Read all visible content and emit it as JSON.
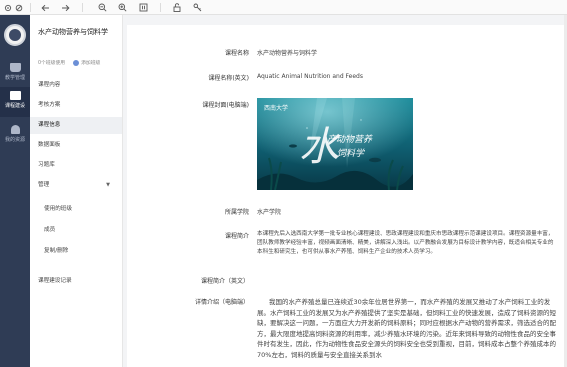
{
  "toolbar": {
    "icons": [
      "settings-icon",
      "link-icon",
      "back-arrow-icon",
      "forward-arrow-icon",
      "zoom-out-icon",
      "zoom-in-icon",
      "fit-page-icon",
      "unlock-icon",
      "key-icon"
    ]
  },
  "nav": {
    "items": [
      {
        "label": "教学管理",
        "icon": "teaching-management-icon"
      },
      {
        "label": "课程建设",
        "icon": "course-building-icon"
      },
      {
        "label": "我的资源",
        "icon": "my-resources-icon"
      }
    ],
    "active_index": 1
  },
  "sidebar": {
    "course_title": "水产动物营养与饲料学",
    "meta_used": "0个班级使用",
    "meta_add": "添加班级",
    "menu": [
      {
        "label": "课程内容"
      },
      {
        "label": "考核方案"
      },
      {
        "label": "课程信息"
      },
      {
        "label": "数据面板"
      },
      {
        "label": "习题库"
      },
      {
        "label": "管理"
      },
      {
        "label": "使用的班级"
      },
      {
        "label": "成员"
      },
      {
        "label": "复制/删除"
      },
      {
        "label": "课程建设记录"
      }
    ],
    "active_index": 2
  },
  "course_info": {
    "name_label": "课程名称",
    "name_value": "水产动物营养与饲料学",
    "name_en_label": "课程名称(英文)",
    "name_en_value": "Aquatic Animal Nutrition and Feeds",
    "cover_label": "课程封面(电脑端)",
    "cover_title_big": "水",
    "cover_title_small": "产动物营养\n饲料学",
    "cover_school": "西南大学",
    "college_label": "所属学院",
    "college_value": "水产学院",
    "intro_label": "课程简介",
    "intro_value": "本课程先后入选西南大学第一批专业核心课程建设、思政课程建设和重庆市思政课程示范课建设项目。课程资源量丰富，团队教师教学经验丰富，视频画面清晰、精美，讲解深入浅出。以产教融合发展为目标设计教学内容，既适合相关专业的本科生和研究生，也可供从事水产养殖、饲料生产企业的技术人员学习。",
    "intro_en_label": "课程简介（英文）",
    "intro_en_value": "",
    "detail_label": "详情介绍（电脑端）",
    "detail_value": "我国的水产养殖总量已连续近30余年位居世界第一，而水产养殖的发展又推动了水产饲料工业的发展。水产饲料工业的发展又为水产养殖提供了坚实是基础，但饲料工业的快速发展，造成了饲料资源的短缺，要解决这一问题，一方面应大力开发新的饲料原料；同时应根据水产动物的营养需求，筛选适合的配方，最大限度地提高饲料资源的利用率，减少养殖水环境的污染。近年来饲料导致的动物性食品的安全事件时有发生，因此，作为动物性食品安全源头的饲料安全也受到重视，目前，饲料成本占整个养殖成本的70%左右，饲料的质量与安全直接关系到水"
  }
}
